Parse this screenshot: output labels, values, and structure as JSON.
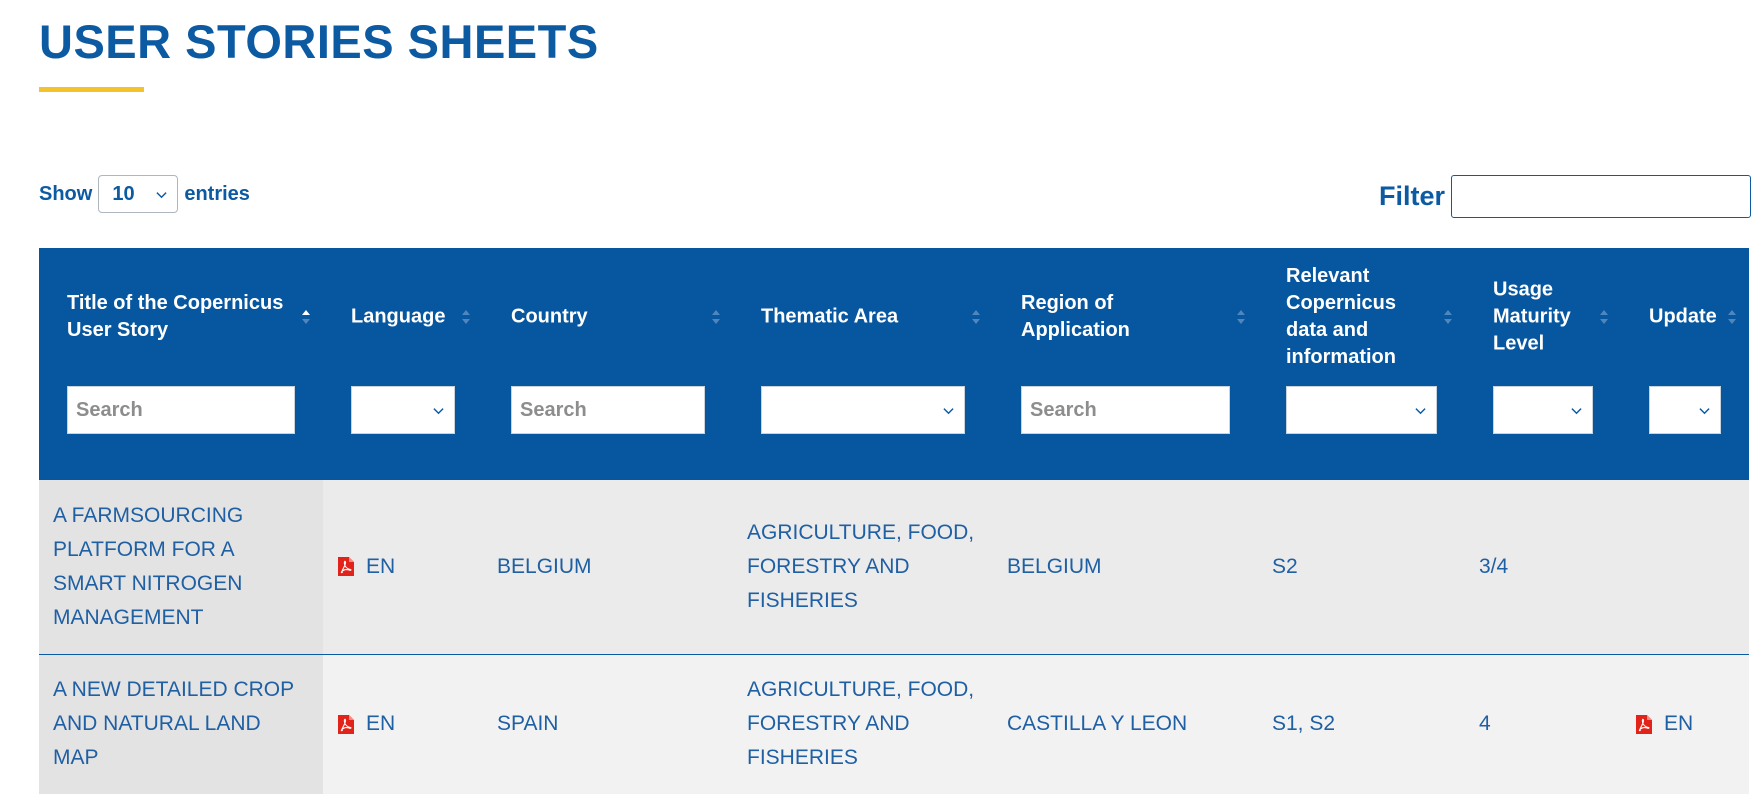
{
  "page": {
    "title": "USER STORIES SHEETS"
  },
  "length": {
    "show_label": "Show",
    "selected": "10",
    "entries_label": "entries"
  },
  "filter": {
    "label": "Filter",
    "value": ""
  },
  "columns": [
    {
      "label": "Title of the Copernicus User Story",
      "filter": "search",
      "placeholder": "Search"
    },
    {
      "label": "Language",
      "filter": "select"
    },
    {
      "label": "Country",
      "filter": "search",
      "placeholder": "Search"
    },
    {
      "label": "Thematic Area",
      "filter": "select"
    },
    {
      "label": "Region of Application",
      "filter": "search",
      "placeholder": "Search"
    },
    {
      "label": "Relevant Copernicus data and information",
      "filter": "select"
    },
    {
      "label": "Usage Maturity Level",
      "filter": "select"
    },
    {
      "label": "Update",
      "filter": "select"
    }
  ],
  "rows": [
    {
      "title": "A FARMSOURCING PLATFORM FOR A SMART NITROGEN MANAGEMENT",
      "language": "EN",
      "country": "BELGIUM",
      "thematic_area": "AGRICULTURE, FOOD, FORESTRY AND FISHERIES",
      "region": "BELGIUM",
      "data": "S2",
      "maturity": "3/4",
      "update": ""
    },
    {
      "title": "A NEW DETAILED CROP AND NATURAL LAND MAP",
      "language": "EN",
      "country": "SPAIN",
      "thematic_area": "AGRICULTURE, FOOD, FORESTRY AND FISHERIES",
      "region": "CASTILLA Y LEON",
      "data": "S1, S2",
      "maturity": "4",
      "update": "EN"
    }
  ],
  "colors": {
    "brand_blue": "#0656a0",
    "text_blue": "#0b5aa2",
    "accent_yellow": "#f4c22b",
    "pdf_red": "#e2231a"
  },
  "icons": {
    "pdf": "pdf-file-icon",
    "sort": "sort-arrows-icon",
    "dropdown": "chevron-down-icon"
  }
}
